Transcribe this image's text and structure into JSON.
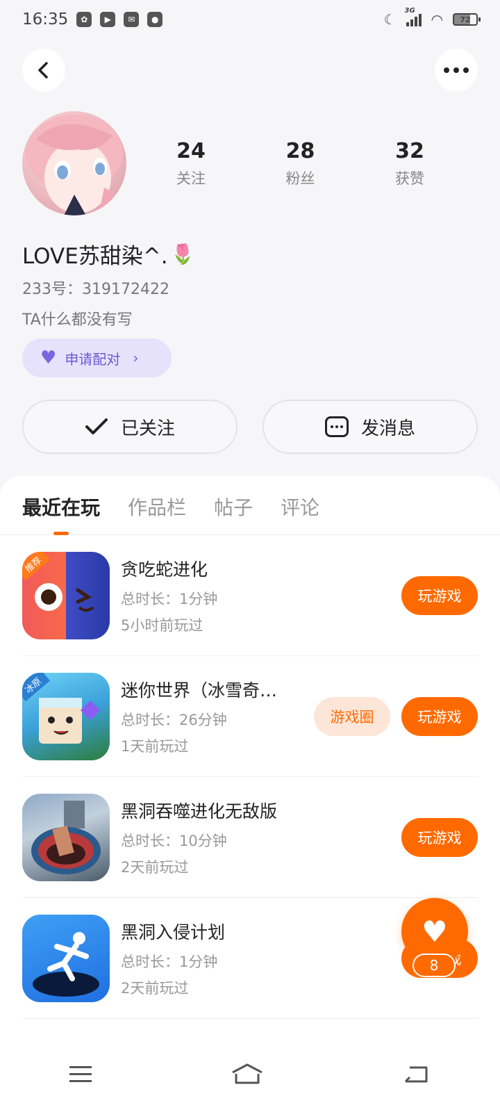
{
  "status_bar": {
    "time": "16:35",
    "network": "3G",
    "battery": "72"
  },
  "profile": {
    "nickname": "LOVE苏甜染^.",
    "nickname_emoji": "🌷",
    "uid": "233号：319172422",
    "bio": "TA什么都没有写",
    "stats": [
      {
        "value": "24",
        "label": "关注"
      },
      {
        "value": "28",
        "label": "粉丝"
      },
      {
        "value": "32",
        "label": "获赞"
      }
    ],
    "pair_label": "申请配对"
  },
  "actions": {
    "follow_label": "已关注",
    "message_label": "发消息"
  },
  "tabs": [
    {
      "label": "最近在玩",
      "active": true
    },
    {
      "label": "作品栏",
      "active": false
    },
    {
      "label": "帖子",
      "active": false
    },
    {
      "label": "评论",
      "active": false
    }
  ],
  "games": [
    {
      "title": "贪吃蛇进化",
      "duration": "总时长：1分钟",
      "last_played": "5小时前玩过",
      "badge": "推荐",
      "play_label": "玩游戏",
      "icon": "snake-game-icon"
    },
    {
      "title": "迷你世界（冰雪奇…",
      "duration": "总时长：26分钟",
      "last_played": "1天前玩过",
      "badge": "冰原",
      "circle_label": "游戏圈",
      "play_label": "玩游戏",
      "icon": "mini-world-icon"
    },
    {
      "title": "黑洞吞噬进化无敌版",
      "duration": "总时长：10分钟",
      "last_played": "2天前玩过",
      "play_label": "玩游戏",
      "icon": "black-hole-game-icon"
    },
    {
      "title": "黑洞入侵计划",
      "duration": "总时长：1分钟",
      "last_played": "2天前玩过",
      "play_label": "玩游戏",
      "icon": "hole-invasion-icon"
    }
  ],
  "floating_like": {
    "count": "8"
  },
  "colors": {
    "accent": "#ff6a00",
    "pair_bg": "#e7e2fb",
    "pair_text": "#6b5bd6"
  }
}
